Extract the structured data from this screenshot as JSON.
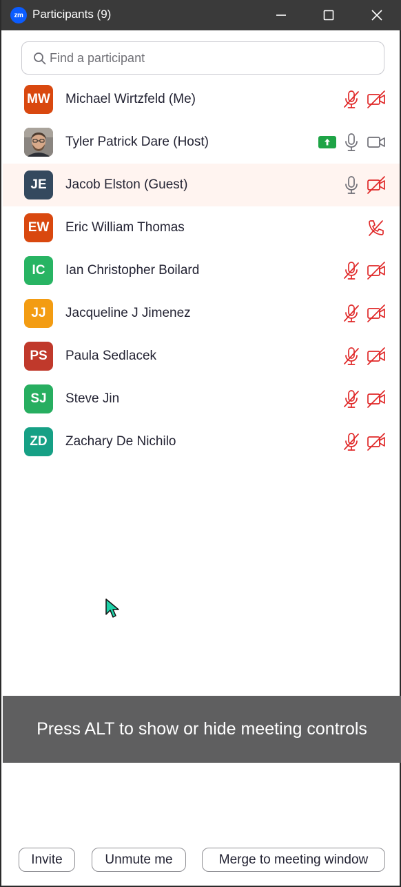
{
  "window": {
    "app_logo": "zm",
    "title": "Participants (9)",
    "controls": [
      "minimize-icon",
      "maximize-icon",
      "close-icon"
    ]
  },
  "search": {
    "placeholder": "Find a participant"
  },
  "participants": [
    {
      "initials": "MW",
      "name": "Michael Wirtzfeld (Me)",
      "avatar_color": "#d9480f",
      "mic": "muted",
      "video": "off",
      "share": false,
      "photo": false,
      "highlight": false
    },
    {
      "initials": "",
      "name": "Tyler Patrick Dare (Host)",
      "avatar_color": "#6b5b4b",
      "mic": "on",
      "video": "on",
      "share": true,
      "photo": true,
      "highlight": false
    },
    {
      "initials": "JE",
      "name": "Jacob Elston (Guest)",
      "avatar_color": "#34495e",
      "mic": "on",
      "video": "off",
      "share": false,
      "photo": false,
      "highlight": true
    },
    {
      "initials": "EW",
      "name": "Eric William Thomas",
      "avatar_color": "#d9480f",
      "mic": "phone-disconnected",
      "video": "none",
      "share": false,
      "photo": false,
      "highlight": false
    },
    {
      "initials": "IC",
      "name": "Ian Christopher Boilard",
      "avatar_color": "#28b463",
      "mic": "muted",
      "video": "off",
      "share": false,
      "photo": false,
      "highlight": false
    },
    {
      "initials": "JJ",
      "name": "Jacqueline J Jimenez",
      "avatar_color": "#f39c12",
      "mic": "muted",
      "video": "off",
      "share": false,
      "photo": false,
      "highlight": false
    },
    {
      "initials": "PS",
      "name": "Paula Sedlacek",
      "avatar_color": "#c0392b",
      "mic": "muted",
      "video": "off",
      "share": false,
      "photo": false,
      "highlight": false
    },
    {
      "initials": "SJ",
      "name": "Steve Jin",
      "avatar_color": "#27ae60",
      "mic": "muted",
      "video": "off",
      "share": false,
      "photo": false,
      "highlight": false
    },
    {
      "initials": "ZD",
      "name": "Zachary De Nichilo",
      "avatar_color": "#16a085",
      "mic": "muted",
      "video": "off",
      "share": false,
      "photo": false,
      "highlight": false
    }
  ],
  "tooltip": {
    "text": "Press ALT to show or hide meeting controls"
  },
  "footer": {
    "invite_label": "Invite",
    "unmute_label": "Unmute me",
    "merge_label": "Merge to meeting window"
  },
  "colors": {
    "muted_red": "#e02828",
    "icon_gray": "#6e6e76",
    "share_green": "#1ea446",
    "titlebar": "#3a3a3a",
    "tooltip_bg": "#5f5f60",
    "cursor": "#1fd1a8"
  }
}
